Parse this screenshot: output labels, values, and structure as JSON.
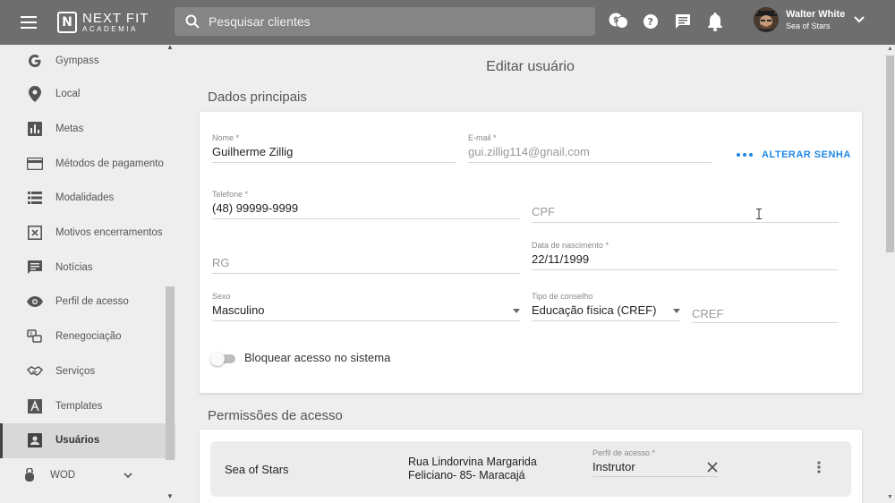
{
  "app": {
    "logo_line1": "NEXT FIT",
    "logo_line2": "ACADEMIA",
    "logo_mark": "N"
  },
  "search": {
    "placeholder": "Pesquisar clientes"
  },
  "top_icons": [
    "dollar-chat-icon",
    "help-icon",
    "message-icon",
    "bell-icon"
  ],
  "user": {
    "name": "Walter White",
    "org": "Sea of Stars"
  },
  "sidebar": {
    "items": [
      {
        "label": "Gympass",
        "icon": "google-g-icon"
      },
      {
        "label": "Local",
        "icon": "location-pin-icon"
      },
      {
        "label": "Metas",
        "icon": "bar-chart-icon"
      },
      {
        "label": "Métodos de pagamento",
        "icon": "credit-card-icon"
      },
      {
        "label": "Modalidades",
        "icon": "list-icon"
      },
      {
        "label": "Motivos encerramentos",
        "icon": "close-box-icon"
      },
      {
        "label": "Notícias",
        "icon": "chat-bubble-icon"
      },
      {
        "label": "Perfil de acesso",
        "icon": "eye-icon"
      },
      {
        "label": "Renegociação",
        "icon": "renegotiation-icon"
      },
      {
        "label": "Serviços",
        "icon": "handshake-icon"
      },
      {
        "label": "Templates",
        "icon": "letter-a-icon"
      },
      {
        "label": "Usuários",
        "icon": "account-box-icon",
        "active": true
      },
      {
        "label": "WOD",
        "icon": "kettlebell-icon"
      }
    ]
  },
  "page": {
    "title": "Editar usuário",
    "main_section": "Dados principais",
    "permissions_section": "Permissões de acesso"
  },
  "form": {
    "nome": {
      "label": "Nome *",
      "value": "Guilherme Zillig"
    },
    "email": {
      "label": "E-mail *",
      "value": "gui.zillig114@gnail.com"
    },
    "alterar_senha": "ALTERAR SENHA",
    "telefone": {
      "label": "Telefone *",
      "value": "(48) 99999-9999"
    },
    "cpf": {
      "placeholder": "CPF"
    },
    "rg": {
      "placeholder": "RG"
    },
    "nascimento": {
      "label": "Data de nascimento *",
      "value": "22/11/1999"
    },
    "sexo": {
      "label": "Sexo",
      "value": "Masculino"
    },
    "conselho": {
      "label": "Tipo de conselho",
      "value": "Educação física (CREF)"
    },
    "cref": {
      "placeholder": "CREF"
    },
    "bloquear": {
      "label": "Bloquear acesso no sistema",
      "enabled": false
    }
  },
  "permissions": [
    {
      "org": "Sea of Stars",
      "address_line1": "Rua Lindorvina Margarida",
      "address_line2": "Feliciano- 85- Maracajá",
      "perfil_label": "Perfil de acesso *",
      "perfil_value": "Instrutor"
    }
  ],
  "colors": {
    "topbar": "#6e6e6e",
    "accent": "#1e88e5",
    "background": "#eeeeee"
  }
}
